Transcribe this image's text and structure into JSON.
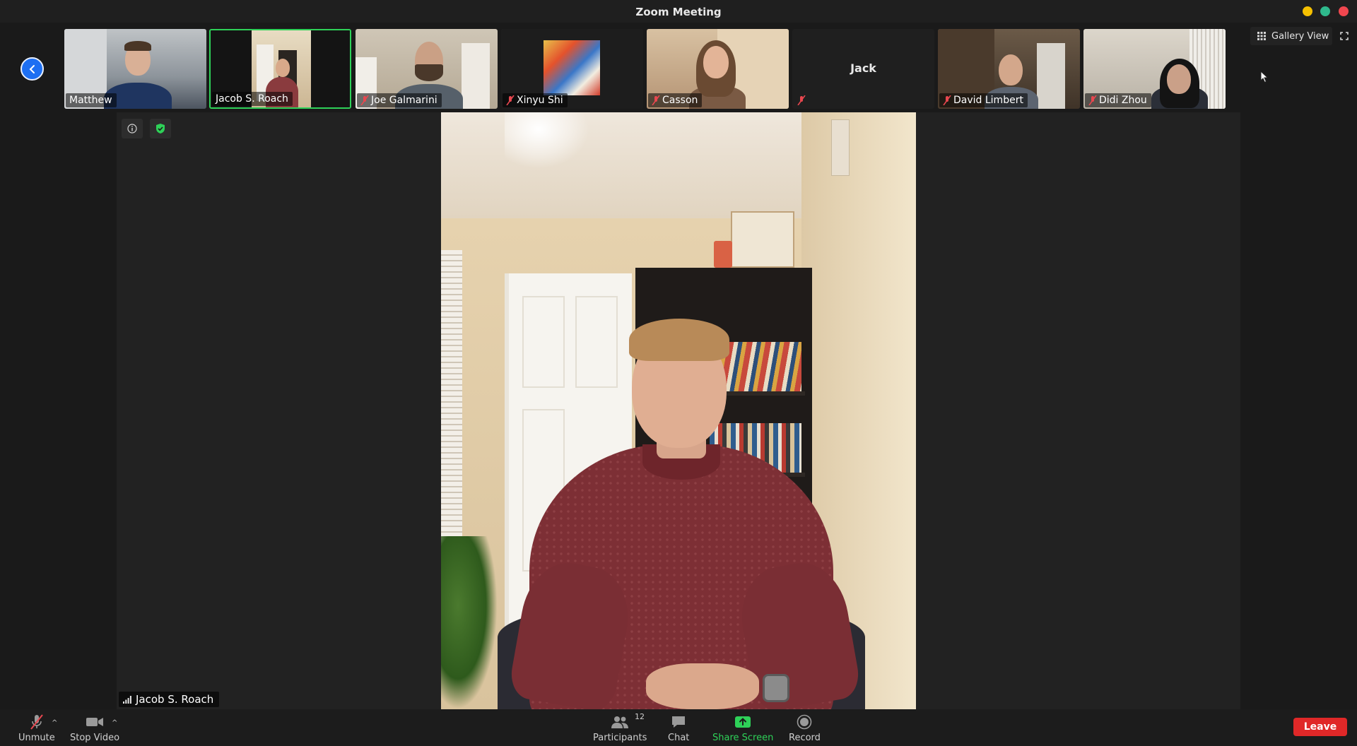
{
  "window": {
    "title": "Zoom Meeting"
  },
  "strip": {
    "participants": [
      {
        "name": "Matthew",
        "muted": false,
        "active": false
      },
      {
        "name": "Jacob S. Roach",
        "muted": false,
        "active": true
      },
      {
        "name": "Joe Galmarini",
        "muted": true,
        "active": false
      },
      {
        "name": "Xinyu Shi",
        "muted": true,
        "active": false
      },
      {
        "name": "Casson",
        "muted": true,
        "active": false
      },
      {
        "name": "Jack",
        "muted": true,
        "active": false,
        "video_off": true
      },
      {
        "name": "David Limbert",
        "muted": true,
        "active": false
      },
      {
        "name": "Didi Zhou",
        "muted": true,
        "active": false
      }
    ],
    "view_button": {
      "label": "Gallery View",
      "icon": "grid-icon"
    }
  },
  "stage": {
    "speaker_name": "Jacob S. Roach"
  },
  "toolbar": {
    "unmute_label": "Unmute",
    "stop_video_label": "Stop Video",
    "participants_label": "Participants",
    "participants_count": "12",
    "chat_label": "Chat",
    "share_screen_label": "Share Screen",
    "record_label": "Record",
    "leave_label": "Leave"
  },
  "colors": {
    "accent_green": "#2ed158",
    "leave_red": "#e02828",
    "back_blue": "#1d6ff2",
    "muted_red": "#e8474f"
  }
}
